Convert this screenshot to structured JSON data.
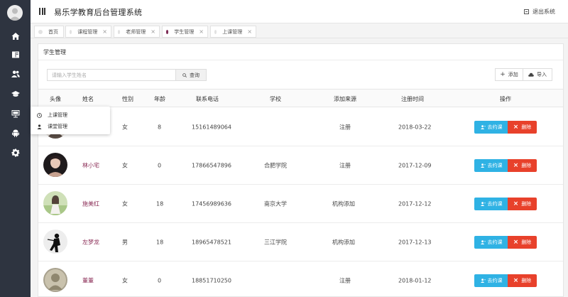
{
  "header": {
    "title": "易乐学教育后台管理系统",
    "logout_label": "退出系统"
  },
  "tabs": [
    {
      "label": "首页",
      "active": false,
      "closable": false
    },
    {
      "label": "课程管理",
      "active": false,
      "closable": true
    },
    {
      "label": "老师管理",
      "active": false,
      "closable": true
    },
    {
      "label": "学生管理",
      "active": true,
      "closable": true
    },
    {
      "label": "上课管理",
      "active": false,
      "closable": true
    }
  ],
  "sidebar": {
    "icons": [
      "home-icon",
      "book-icon",
      "users-icon",
      "graduation-cap-icon",
      "presentation-icon",
      "android-icon",
      "gear-icon"
    ],
    "flyout": [
      {
        "label": "上课管理",
        "icon": "clock-icon"
      },
      {
        "label": "课堂管理",
        "icon": "user-icon"
      }
    ]
  },
  "panel": {
    "title": "学生管理",
    "search_placeholder": "请输入学生姓名",
    "search_label": "查询",
    "add_label": "添加",
    "import_label": "导入"
  },
  "table": {
    "columns": [
      "头像",
      "姓名",
      "性别",
      "年龄",
      "联系电话",
      "学校",
      "添加来源",
      "注册时间",
      "操作"
    ],
    "rows": [
      {
        "name": "",
        "gender": "女",
        "age": "8",
        "phone": "15161489064",
        "school": "",
        "source": "注册",
        "date": "2018-03-22"
      },
      {
        "name": "林小宅",
        "gender": "女",
        "age": "0",
        "phone": "17866547896",
        "school": "合肥学院",
        "source": "注册",
        "date": "2017-12-09"
      },
      {
        "name": "施美红",
        "gender": "女",
        "age": "18",
        "phone": "17456989636",
        "school": "南京大学",
        "source": "机构添加",
        "date": "2017-12-12"
      },
      {
        "name": "左梦龙",
        "gender": "男",
        "age": "18",
        "phone": "18965478521",
        "school": "三江学院",
        "source": "机构添加",
        "date": "2017-12-13"
      },
      {
        "name": "董董",
        "gender": "女",
        "age": "0",
        "phone": "18851710250",
        "school": "",
        "source": "注册",
        "date": "2018-01-12"
      }
    ],
    "book_label": "去约课",
    "delete_label": "删除"
  },
  "colors": {
    "sidebar": "#2e3440",
    "accent": "#8a2b55",
    "book": "#2fb2e4",
    "delete": "#e8412b"
  }
}
